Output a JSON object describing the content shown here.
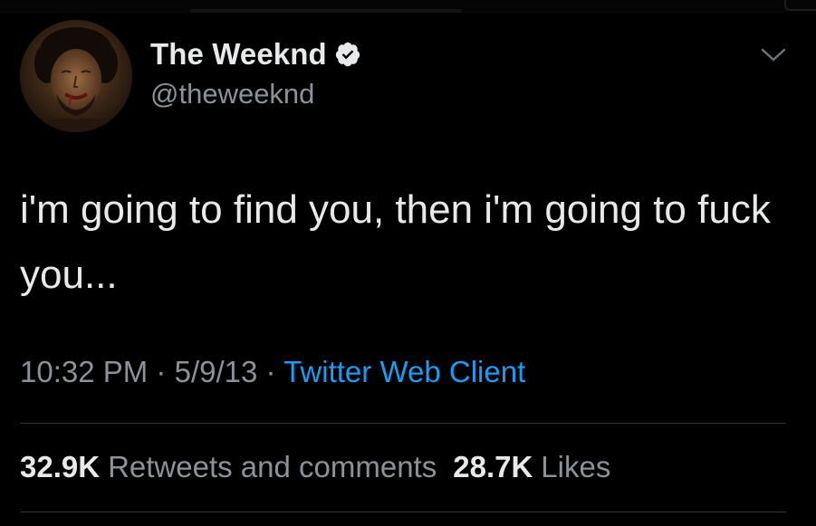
{
  "tweet": {
    "display_name": "The Weeknd",
    "handle": "@theweeknd",
    "text": "i'm going to find you, then i'm going to fuck you...",
    "time": "10:32 PM",
    "date": "5/9/13",
    "separator": "·",
    "source": "Twitter Web Client",
    "retweets_count": "32.9K",
    "retweets_label": "Retweets and comments",
    "likes_count": "28.7K",
    "likes_label": "Likes"
  },
  "icons": {
    "verified": "verified-badge-icon",
    "more": "chevron-down-icon",
    "avatar": "profile-avatar"
  },
  "colors": {
    "background": "#000000",
    "primary_text": "#e7e9ea",
    "secondary_text": "#8b9298",
    "link": "#1d9bf0",
    "divider": "#2f3336"
  }
}
